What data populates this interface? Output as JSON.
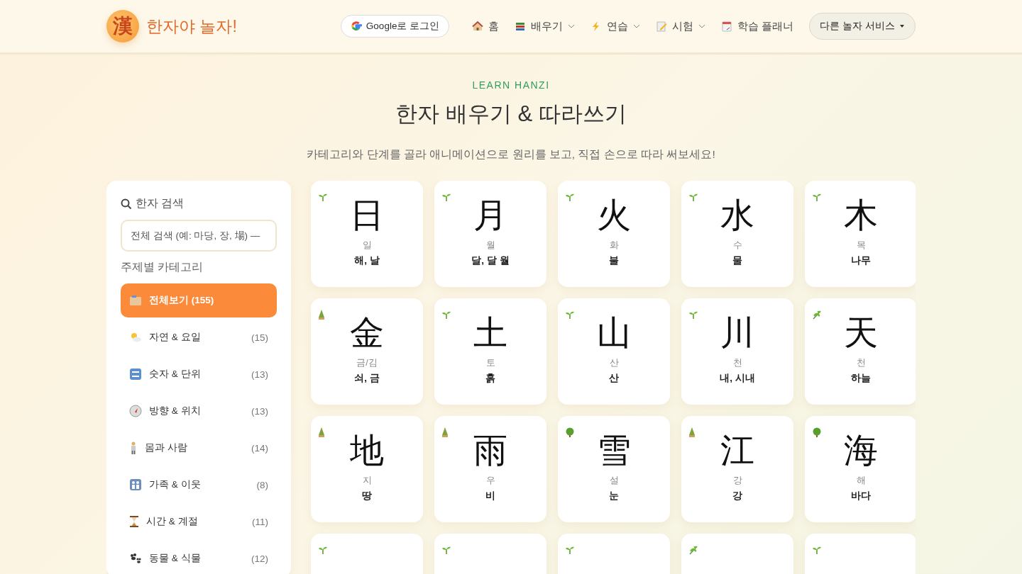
{
  "header": {
    "logo_mark": "漢",
    "site_title": "한자야 놀자!",
    "login_button": "Google로 로그인",
    "nav": [
      {
        "label": "홈",
        "has_menu": false
      },
      {
        "label": "배우기",
        "has_menu": true
      },
      {
        "label": "연습",
        "has_menu": true
      },
      {
        "label": "시험",
        "has_menu": true
      },
      {
        "label": "학습 플래너",
        "has_menu": false
      }
    ],
    "services_button": "다른 놀자 서비스"
  },
  "hero": {
    "eyebrow": "LEARN HANZI",
    "title": "한자 배우기 & 따라쓰기",
    "subtitle": "카테고리와 단계를 골라 애니메이션으로 원리를 보고, 직접 손으로 따라 써보세요!"
  },
  "sidebar": {
    "search_title": "한자 검색",
    "search_placeholder": "전체 검색 (예: 마당, 장, 場) —",
    "categories_title": "주제별 카테고리",
    "categories": [
      {
        "label": "전체보기 (155)",
        "selected": true
      },
      {
        "label": "자연 & 요일",
        "count": "(15)",
        "selected": false
      },
      {
        "label": "숫자 & 단위",
        "count": "(13)",
        "selected": false
      },
      {
        "label": "방향 & 위치",
        "count": "(13)",
        "selected": false
      },
      {
        "label": "몸과 사람",
        "count": "(14)",
        "selected": false
      },
      {
        "label": "가족 & 이웃",
        "count": "(8)",
        "selected": false
      },
      {
        "label": "시간 & 계절",
        "count": "(11)",
        "selected": false
      },
      {
        "label": "동물 & 식물",
        "count": "(12)",
        "selected": false
      }
    ]
  },
  "cards": [
    {
      "hanzi": "日",
      "reading": "일",
      "meaning": "해, 날",
      "kind": "sprout"
    },
    {
      "hanzi": "月",
      "reading": "월",
      "meaning": "달, 달 월",
      "kind": "sprout"
    },
    {
      "hanzi": "火",
      "reading": "화",
      "meaning": "불",
      "kind": "sprout"
    },
    {
      "hanzi": "水",
      "reading": "수",
      "meaning": "물",
      "kind": "sprout"
    },
    {
      "hanzi": "木",
      "reading": "목",
      "meaning": "나무",
      "kind": "sprout"
    },
    {
      "hanzi": "金",
      "reading": "금/김",
      "meaning": "쇠, 금",
      "kind": "pine"
    },
    {
      "hanzi": "土",
      "reading": "토",
      "meaning": "흙",
      "kind": "sprout"
    },
    {
      "hanzi": "山",
      "reading": "산",
      "meaning": "산",
      "kind": "sprout"
    },
    {
      "hanzi": "川",
      "reading": "천",
      "meaning": "내, 시내",
      "kind": "sprout"
    },
    {
      "hanzi": "天",
      "reading": "천",
      "meaning": "하늘",
      "kind": "herb"
    },
    {
      "hanzi": "地",
      "reading": "지",
      "meaning": "땅",
      "kind": "pine"
    },
    {
      "hanzi": "雨",
      "reading": "우",
      "meaning": "비",
      "kind": "pine"
    },
    {
      "hanzi": "雪",
      "reading": "설",
      "meaning": "눈",
      "kind": "tree"
    },
    {
      "hanzi": "江",
      "reading": "강",
      "meaning": "강",
      "kind": "pine"
    },
    {
      "hanzi": "海",
      "reading": "해",
      "meaning": "바다",
      "kind": "tree"
    },
    {
      "kind": "sprout"
    },
    {
      "kind": "sprout"
    },
    {
      "kind": "sprout"
    },
    {
      "kind": "herb"
    },
    {
      "kind": "sprout"
    }
  ]
}
